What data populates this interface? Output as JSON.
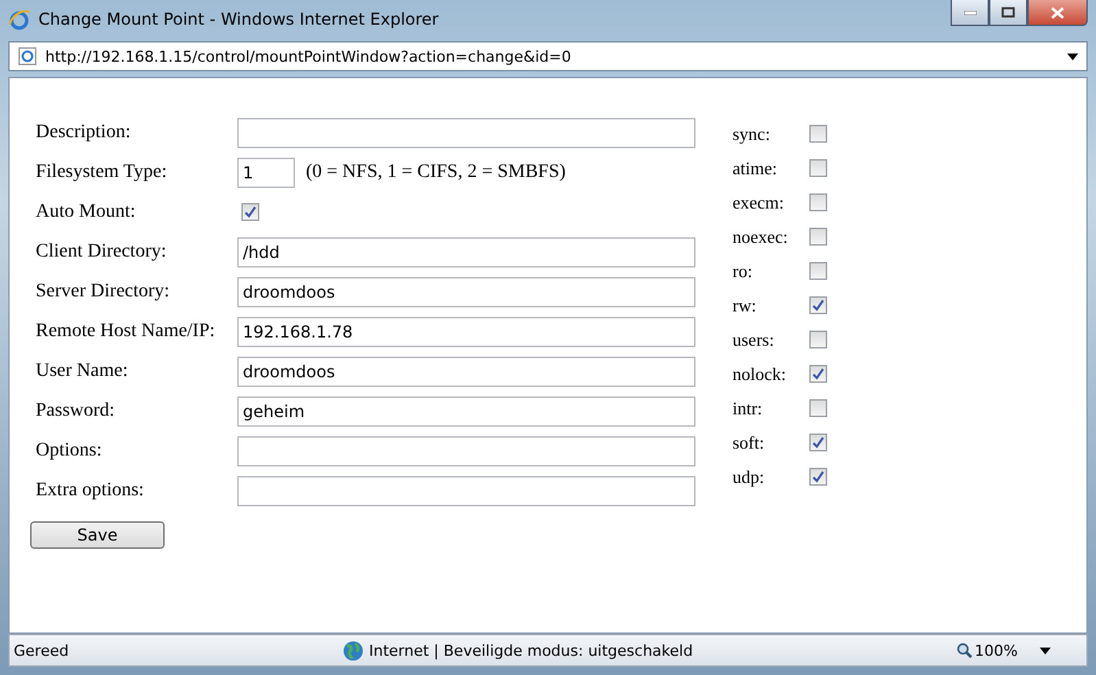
{
  "window": {
    "title": "Change Mount Point - Windows Internet Explorer"
  },
  "address_bar": {
    "url": "http://192.168.1.15/control/mountPointWindow?action=change&id=0"
  },
  "fields": [
    {
      "kind": "text",
      "label": "Description:"
    },
    {
      "kind": "short",
      "label": "Filesystem Type:",
      "value": "1",
      "hint": "(0 = NFS, 1 = CIFS, 2 = SMBFS)"
    },
    {
      "kind": "checkbox",
      "label": "Auto Mount:",
      "checked": true
    },
    {
      "kind": "text",
      "label": "Client Directory:",
      "value": "/hdd"
    },
    {
      "kind": "text",
      "label": "Server Directory:",
      "value": "droomdoos"
    },
    {
      "kind": "text",
      "label": "Remote Host Name/IP:",
      "value": "192.168.1.78"
    },
    {
      "kind": "text",
      "label": "User Name:",
      "value": "droomdoos"
    },
    {
      "kind": "text",
      "label": "Password:",
      "value": "geheim"
    },
    {
      "kind": "text",
      "label": "Options:"
    },
    {
      "kind": "text",
      "label": "Extra options:"
    }
  ],
  "options": [
    {
      "label": "sync:",
      "checked": false
    },
    {
      "label": "atime:",
      "checked": false
    },
    {
      "label": "execm:",
      "checked": false
    },
    {
      "label": "noexec:",
      "checked": false
    },
    {
      "label": "ro:",
      "checked": false
    },
    {
      "label": "rw:",
      "checked": true
    },
    {
      "label": "users:",
      "checked": false
    },
    {
      "label": "nolock:",
      "checked": true
    },
    {
      "label": "intr:",
      "checked": false
    },
    {
      "label": "soft:",
      "checked": true
    },
    {
      "label": "udp:",
      "checked": true
    }
  ],
  "save_button": "Save",
  "status_bar": {
    "status": "Gereed",
    "zone": "Internet | Beveiligde modus: uitgeschakeld",
    "zoom": "100%"
  }
}
